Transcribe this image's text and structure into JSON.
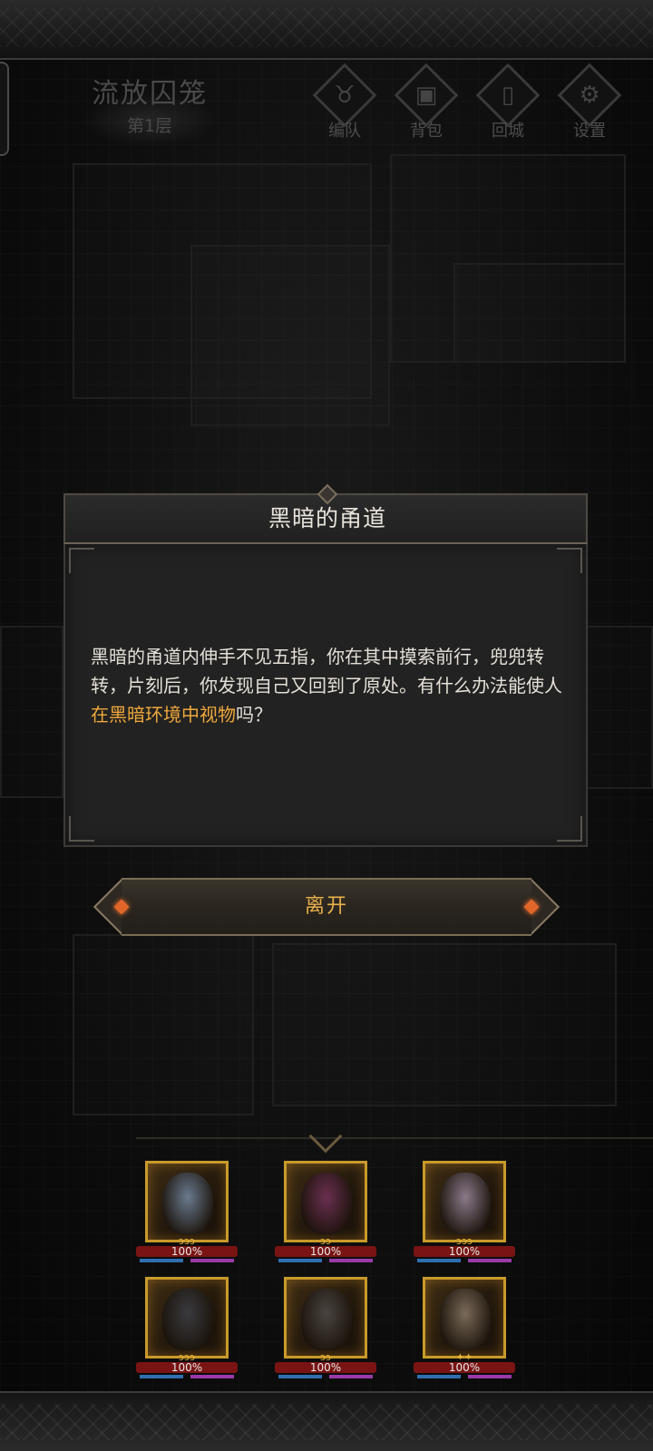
{
  "level": {
    "name": "流放囚笼",
    "floor": "第1层"
  },
  "menu": [
    {
      "id": "team",
      "label": "编队",
      "icon": "horned-helmet-icon",
      "glyph": "♉"
    },
    {
      "id": "bag",
      "label": "背包",
      "icon": "bag-icon",
      "glyph": "▣"
    },
    {
      "id": "return",
      "label": "回城",
      "icon": "door-icon",
      "glyph": "▯"
    },
    {
      "id": "settings",
      "label": "设置",
      "icon": "gear-icon",
      "glyph": "⚙"
    }
  ],
  "dialog": {
    "title": "黑暗的甬道",
    "text_before": "黑暗的甬道内伸手不见五指，你在其中摸索前行，兜兜转转，片刻后，你发现自己又回到了原处。有什么办法能使人",
    "text_highlight": "在黑暗环境中视物",
    "text_after": "吗？",
    "highlight_color": "#f0a83a"
  },
  "leave_button": {
    "label": "离开"
  },
  "team": {
    "heroes": [
      {
        "hp": "100%",
        "stars": "ɔɔɔ",
        "portrait_color": "#6a7a8e"
      },
      {
        "hp": "100%",
        "stars": "ɔɔ",
        "portrait_color": "#6a3050"
      },
      {
        "hp": "100%",
        "stars": "ɔɔɔ",
        "portrait_color": "#8a7a8a"
      },
      {
        "hp": "100%",
        "stars": "ɔɔɔ",
        "portrait_color": "#3a3a3e"
      },
      {
        "hp": "100%",
        "stars": "ɔɔ",
        "portrait_color": "#4a4440"
      },
      {
        "hp": "100%",
        "stars": "✦✦",
        "portrait_color": "#7a6a58"
      }
    ]
  },
  "colors": {
    "accent_gold": "#e9b04a",
    "hp_red": "#7a1414",
    "mp_blue": "#2f6fb0",
    "sp_purple": "#9a3aa8"
  }
}
